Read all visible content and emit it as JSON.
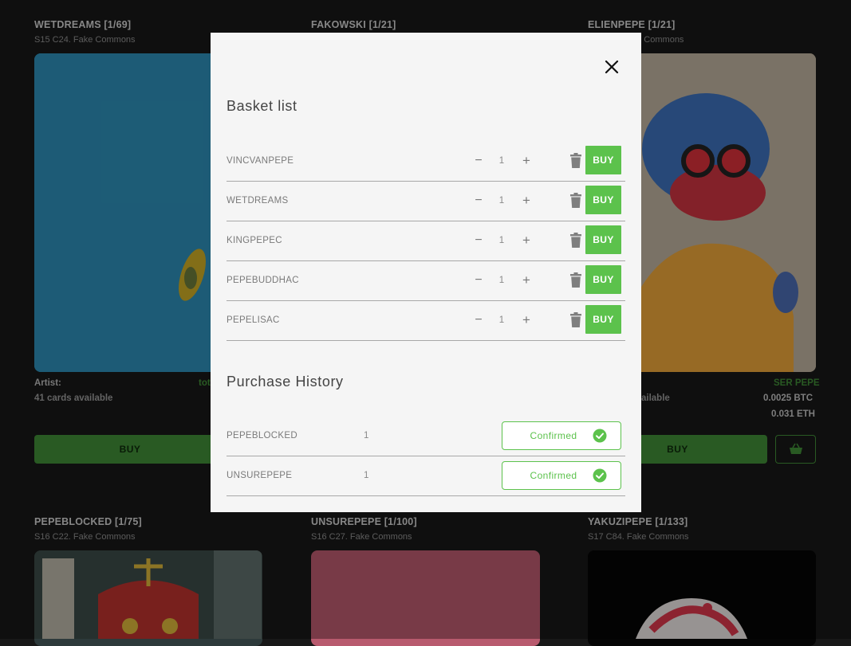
{
  "cards": [
    {
      "title": "WETDREAMS [1/69]",
      "subtitle": "S15 C24. Fake Commons"
    },
    {
      "title": "FAKOWSKI [1/21]",
      "subtitle": ""
    },
    {
      "title": "ELIENPEPE [1/21]",
      "subtitle": "S15 C... Fake Commons"
    },
    {
      "title": "PEPEBLOCKED [1/75]",
      "subtitle": "S16 C22. Fake Commons"
    },
    {
      "title": "UNSUREPEPE [1/100]",
      "subtitle": "S16 C27. Fake Commons"
    },
    {
      "title": "YAKUZIPEPE [1/133]",
      "subtitle": "S17 C84. Fake Commons"
    }
  ],
  "card1": {
    "artist_label": "Artist:",
    "artist_value": "tot",
    "available": "41 cards available",
    "buy_label": "BUY"
  },
  "card3": {
    "artist_value": "SER PEPE",
    "available": "ailable",
    "price_btc": "0.0025 BTC",
    "price_eth": "0.031 ETH",
    "buy_label": "BUY"
  },
  "modal": {
    "basket_title": "Basket list",
    "basket_items": [
      {
        "name": "VINCVANPEPE",
        "qty": "1",
        "buy": "BUY"
      },
      {
        "name": "WETDREAMS",
        "qty": "1",
        "buy": "BUY"
      },
      {
        "name": "KINGPEPEC",
        "qty": "1",
        "buy": "BUY"
      },
      {
        "name": "PEPEBUDDHAC",
        "qty": "1",
        "buy": "BUY"
      },
      {
        "name": "PEPELISAC",
        "qty": "1",
        "buy": "BUY"
      }
    ],
    "minus": "−",
    "plus": "+",
    "history_title": "Purchase History",
    "history_items": [
      {
        "name": "PEPEBLOCKED",
        "qty": "1",
        "status": "Confirmed"
      },
      {
        "name": "UNSUREPEPE",
        "qty": "1",
        "status": "Confirmed"
      }
    ]
  },
  "colors": {
    "accent": "#5cc24c",
    "dark_accent": "#3f8a36",
    "page_bg": "#181818",
    "modal_bg": "#f5f5f5"
  }
}
